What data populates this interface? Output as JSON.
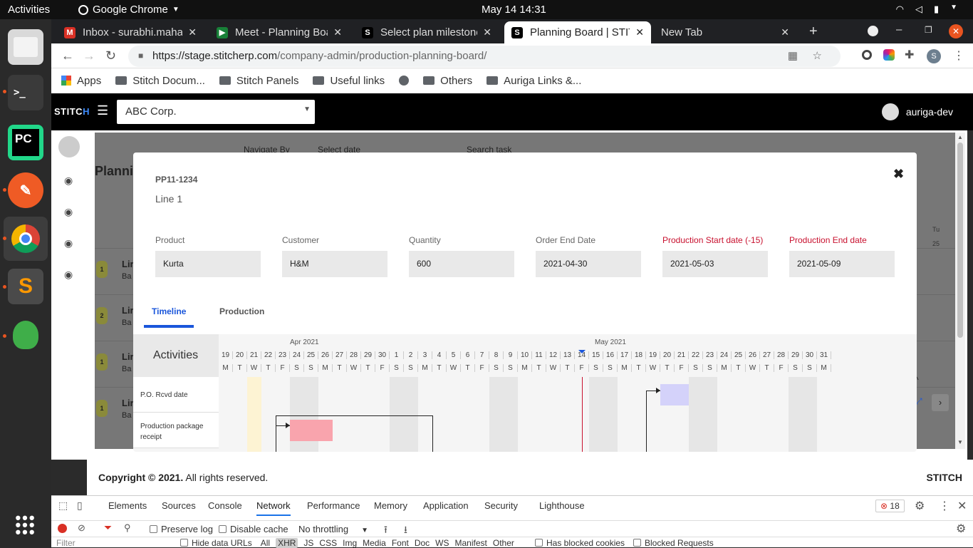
{
  "os": {
    "activities": "Activities",
    "app": "Google Chrome",
    "clock": "May 14  14:31"
  },
  "tabs": [
    {
      "title": "Inbox - surabhi.maha",
      "color": "#d93025",
      "glyph": "M"
    },
    {
      "title": "Meet - Planning Boar",
      "color": "#188038",
      "glyph": "▶"
    },
    {
      "title": "Select plan milestone",
      "color": "#000",
      "glyph": "S"
    },
    {
      "title": "Planning Board | STIT",
      "color": "#000",
      "glyph": "S"
    },
    {
      "title": "New Tab",
      "color": "",
      "glyph": ""
    }
  ],
  "url": {
    "host": "https://stage.stitcherp.com",
    "path": "/company-admin/production-planning-board/"
  },
  "bookmarks": [
    "Apps",
    "Stitch Docum...",
    "Stitch Panels",
    "Useful links",
    "Others",
    "Auriga Links &..."
  ],
  "app": {
    "logo_a": "STITC",
    "logo_b": "H",
    "company": "ABC Corp.",
    "user": "auriga-dev"
  },
  "bg": {
    "title": "Planni",
    "navigate": "Navigate By",
    "select_date": "Select date",
    "search": "Search task",
    "rows": [
      "1",
      "2",
      "1",
      "1"
    ],
    "row_label": "Lir",
    "row_sub": "Ba",
    "day": "Tu",
    "num": "25"
  },
  "modal": {
    "code": "PP11-1234",
    "line": "Line 1",
    "fields": [
      {
        "label": "Product",
        "value": "Kurta",
        "red": false
      },
      {
        "label": "Customer",
        "value": "H&M",
        "red": false
      },
      {
        "label": "Quantity",
        "value": "600",
        "red": false
      },
      {
        "label": "Order End Date",
        "value": "2021-04-30",
        "red": false
      },
      {
        "label": "Production Start date (-15)",
        "value": "2021-05-03",
        "red": true
      },
      {
        "label": "Production End date",
        "value": "2021-05-09",
        "red": true
      }
    ],
    "tabs": [
      "Timeline",
      "Production"
    ],
    "activities_header": "Activities",
    "months": [
      "Apr 2021",
      "May 2021"
    ],
    "days": [
      "19",
      "20",
      "21",
      "22",
      "23",
      "24",
      "25",
      "26",
      "27",
      "28",
      "29",
      "30",
      "1",
      "2",
      "3",
      "4",
      "5",
      "6",
      "7",
      "8",
      "9",
      "10",
      "11",
      "12",
      "13",
      "14",
      "15",
      "16",
      "17",
      "18",
      "19",
      "20",
      "21",
      "22",
      "23",
      "24",
      "25",
      "26",
      "27",
      "28",
      "29",
      "30",
      "31"
    ],
    "weekdays": [
      "M",
      "T",
      "W",
      "T",
      "F",
      "S",
      "S",
      "M",
      "T",
      "W",
      "T",
      "F",
      "S",
      "S",
      "M",
      "T",
      "W",
      "T",
      "F",
      "S",
      "S",
      "M",
      "T",
      "W",
      "T",
      "F",
      "S",
      "S",
      "M",
      "T",
      "W",
      "T",
      "F",
      "S",
      "S",
      "M",
      "T",
      "W",
      "T",
      "F",
      "S",
      "S",
      "M"
    ],
    "activities": [
      "P.O. Rcvd date",
      "Production package receipt"
    ]
  },
  "footer": {
    "copyright": "Copyright © 2021.",
    "rights": " All rights reserved.",
    "brand": "STITCH"
  },
  "devtools": {
    "tabs": [
      "Elements",
      "Sources",
      "Console",
      "Network",
      "Performance",
      "Memory",
      "Application",
      "Security",
      "Lighthouse"
    ],
    "errors": "18",
    "preserve": "Preserve log",
    "disable": "Disable cache",
    "throttle": "No throttling",
    "filter": "Filter",
    "types": [
      "Hide data URLs",
      "All",
      "XHR",
      "JS",
      "CSS",
      "Img",
      "Media",
      "Font",
      "Doc",
      "WS",
      "Manifest",
      "Other"
    ],
    "blocked_cookies": "Has blocked cookies",
    "blocked_req": "Blocked Requests"
  }
}
